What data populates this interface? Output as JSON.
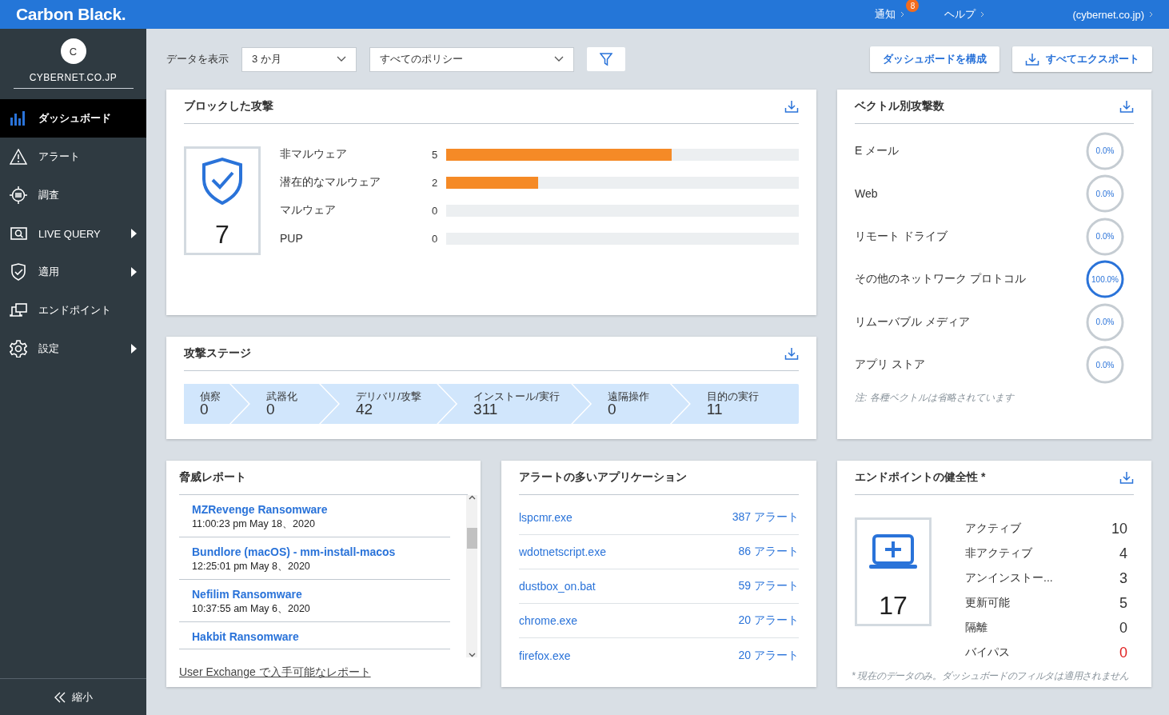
{
  "header": {
    "logo": "Carbon Black.",
    "nav": [
      {
        "label": "通知",
        "badge": "8"
      },
      {
        "label": "ヘルプ"
      },
      {
        "label": "(cybernet.co.jp)"
      }
    ]
  },
  "sidebar": {
    "avatar": "C",
    "org": "CYBERNET.CO.JP",
    "items": [
      {
        "label": "ダッシュボード",
        "selected": true,
        "submenu": false
      },
      {
        "label": "アラート",
        "selected": false,
        "submenu": false
      },
      {
        "label": "調査",
        "selected": false,
        "submenu": false
      },
      {
        "label": "LIVE QUERY",
        "selected": false,
        "submenu": true
      },
      {
        "label": "適用",
        "selected": false,
        "submenu": true
      },
      {
        "label": "エンドポイント",
        "selected": false,
        "submenu": false
      },
      {
        "label": "設定",
        "selected": false,
        "submenu": true
      }
    ],
    "collapse": "縮小"
  },
  "toolbar": {
    "label": "データを表示",
    "period": "3 か月",
    "policy": "すべてのポリシー",
    "buttons": [
      "ダッシュボードを構成",
      "すべてエクスポート"
    ]
  },
  "blocked": {
    "title": "ブロックした攻撃",
    "total": "7",
    "rows": [
      {
        "label": "非マルウェア",
        "count": "5",
        "level": 0.64
      },
      {
        "label": "潜在的なマルウェア",
        "count": "2",
        "level": 0.26
      },
      {
        "label": "マルウェア",
        "count": "0",
        "level": 0
      },
      {
        "label": "PUP",
        "count": "0",
        "level": 0
      }
    ]
  },
  "stages": {
    "title": "攻撃ステージ",
    "items": [
      {
        "label": "偵察",
        "value": "0"
      },
      {
        "label": "武器化",
        "value": "0"
      },
      {
        "label": "デリバリ/攻撃",
        "value": "42"
      },
      {
        "label": "インストール/実行",
        "value": "311"
      },
      {
        "label": "遠隔操作",
        "value": "0"
      },
      {
        "label": "目的の実行",
        "value": "11"
      }
    ]
  },
  "vectors": {
    "title": "ベクトル別攻撃数",
    "items": [
      {
        "label": "E メール",
        "percent": "0.0%",
        "active": false
      },
      {
        "label": "Web",
        "percent": "0.0%",
        "active": false
      },
      {
        "label": "リモート ドライブ",
        "percent": "0.0%",
        "active": false
      },
      {
        "label": "その他のネットワーク プロトコル",
        "percent": "100.0%",
        "active": true
      },
      {
        "label": "リムーバブル メディア",
        "percent": "0.0%",
        "active": false
      },
      {
        "label": "アプリ ストア",
        "percent": "0.0%",
        "active": false
      }
    ],
    "note": "注: 各種ベクトルは省略されています"
  },
  "threats": {
    "title": "脅威レポート",
    "items": [
      {
        "name": "MZRevenge Ransomware",
        "time": "11:00:23 pm May 18、2020"
      },
      {
        "name": "Bundlore (macOS) - mm-install-macos",
        "time": "12:25:01 pm May 8、2020"
      },
      {
        "name": "Nefilim Ransomware",
        "time": "10:37:55 am May 6、2020"
      },
      {
        "name": "Hakbit Ransomware"
      }
    ],
    "link": "User Exchange で入手可能なレポート"
  },
  "apps": {
    "title": "アラートの多いアプリケーション",
    "items": [
      {
        "name": "lspcmr.exe",
        "alerts": "387 アラート"
      },
      {
        "name": "wdotnetscript.exe",
        "alerts": "86 アラート"
      },
      {
        "name": "dustbox_on.bat",
        "alerts": "59 アラート"
      },
      {
        "name": "chrome.exe",
        "alerts": "20 アラート"
      },
      {
        "name": "firefox.exe",
        "alerts": "20 アラート"
      }
    ]
  },
  "health": {
    "title": "エンドポイントの健全性 *",
    "total": "17",
    "rows": [
      {
        "label": "アクティブ",
        "value": "10",
        "warning": false
      },
      {
        "label": "非アクティブ",
        "value": "4",
        "warning": false
      },
      {
        "label": "アンインストー...",
        "value": "3",
        "warning": false
      },
      {
        "label": "更新可能",
        "value": "5",
        "warning": false
      },
      {
        "label": "隔離",
        "value": "0",
        "warning": false
      },
      {
        "label": "バイパス",
        "value": "0",
        "warning": true
      }
    ],
    "note": "* 現在のデータのみ。ダッシュボードのフィルタは適用されません"
  }
}
